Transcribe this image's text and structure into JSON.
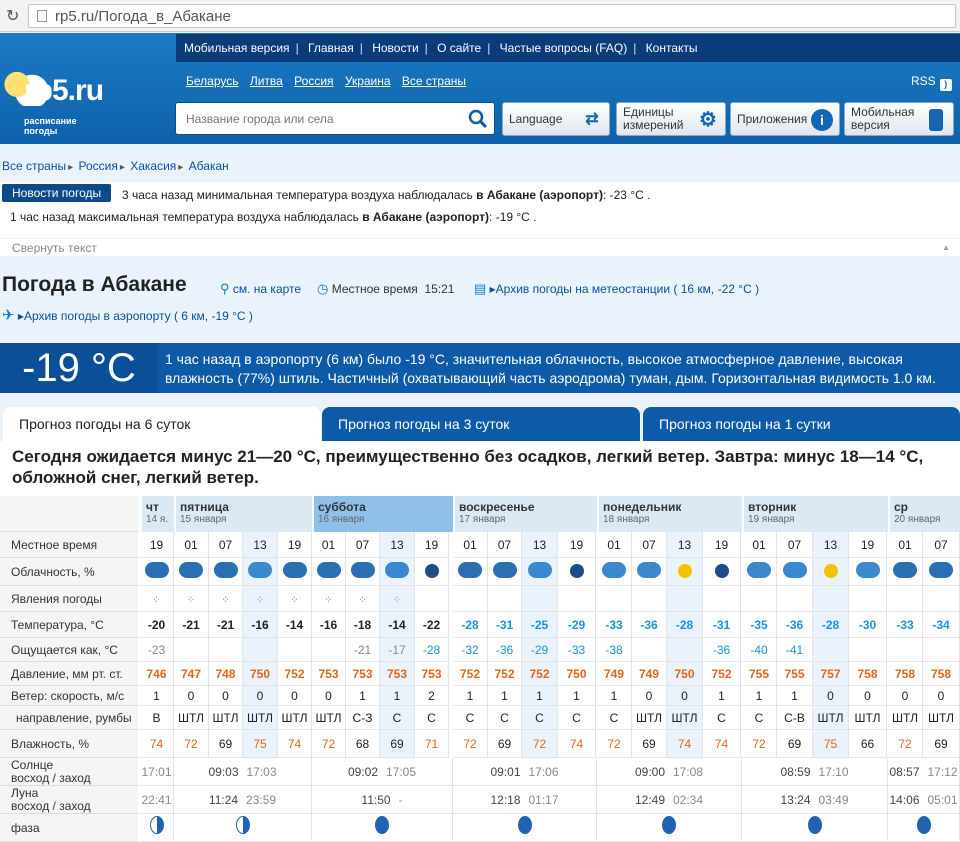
{
  "browser": {
    "url": "rp5.ru/Погода_в_Абакане"
  },
  "topnav": [
    "Мобильная версия",
    "Главная",
    "Новости",
    "О сайте",
    "Частые вопросы (FAQ)",
    "Контакты"
  ],
  "logo": {
    "word": "rp5.ru",
    "sub": "расписание погоды"
  },
  "countries": [
    "Беларусь",
    "Литва",
    "Россия",
    "Украина",
    "Все страны"
  ],
  "rss": "RSS",
  "search": {
    "placeholder": "Название города или села"
  },
  "header_buttons": {
    "language": "Language",
    "units": "Единицы измерений",
    "apps": "Приложения",
    "mobile": "Мобильная версия"
  },
  "breadcrumbs": [
    "Все страны",
    "Россия",
    "Хакасия",
    "Абакан"
  ],
  "news": {
    "badge": "Новости погоды",
    "line1_pre": "3 часа назад минимальная температура воздуха наблюдалась ",
    "line1_bold": "в Абакане (аэропорт)",
    "line1_post": ": -23 °C .",
    "line2_pre": "1 час назад максимальная температура воздуха наблюдалась ",
    "line2_bold": "в Абакане (аэропорт)",
    "line2_post": ": -19 °C .",
    "collapse": "Свернуть текст"
  },
  "title": "Погода в Абакане",
  "meta": {
    "map": "см. на карте",
    "local_time_label": "Местное время",
    "local_time": "15:21",
    "archive_station": "Архив погоды на метеостанции ( 16 км, -22 °C )",
    "archive_airport": "Архив погоды в аэропорту ( 6 км, -19 °C )"
  },
  "now": {
    "temp": "-19 °C",
    "desc": "1 час назад в аэропорту (6 км) было -19 °C, значительная облачность, высокое атмосферное давление, высокая влажность (77%) штиль. Частичный (охватывающий часть аэродрома) туман, дым. Горизонтальная видимость 1.0 км."
  },
  "tabs": [
    "Прогноз погоды на 6 суток",
    "Прогноз погоды на 3 суток",
    "Прогноз погоды на 1 сутки"
  ],
  "summary": "Сегодня ожидается минус 21—20 °C, преимущественно без осадков, легкий ветер. Завтра: минус 18—14 °C, обложной снег, легкий ветер.",
  "days": [
    {
      "name": "чт",
      "date": "14 я."
    },
    {
      "name": "пятница",
      "date": "15 января"
    },
    {
      "name": "суббота",
      "date": "16 января"
    },
    {
      "name": "воскресенье",
      "date": "17 января"
    },
    {
      "name": "понедельник",
      "date": "18 января"
    },
    {
      "name": "вторник",
      "date": "19 января"
    },
    {
      "name": "ср",
      "date": "20 января"
    }
  ],
  "row_labels": {
    "time": "Местное время",
    "cloud": "Облачность, %",
    "phen": "Явления погоды",
    "temp": "Температура, °C",
    "feels": "Ощущается как, °C",
    "pressure": "Давление, мм рт. ст.",
    "wind1": "Ветер: скорость, м/с",
    "wind2": "направление, румбы",
    "humidity": "Влажность, %",
    "sun1": "Солнце",
    "sun2": "восход / заход",
    "moon1": "Луна",
    "moon2": "восход / заход",
    "phase": "фаза"
  },
  "times": [
    "19",
    "01",
    "07",
    "13",
    "19",
    "01",
    "07",
    "13",
    "19",
    "01",
    "07",
    "13",
    "19",
    "01",
    "07",
    "13",
    "19",
    "01",
    "07",
    "13",
    "19",
    "01",
    "07"
  ],
  "cloud_icons": [
    "cloud",
    "cloud",
    "cloud",
    "light",
    "cloud",
    "cloud",
    "cloud",
    "light",
    "night",
    "cloud",
    "cloud",
    "light",
    "night",
    "light",
    "light",
    "sun",
    "night",
    "light",
    "light",
    "sun",
    "light",
    "cloud",
    "cloud"
  ],
  "temps": [
    "-20",
    "-21",
    "-21",
    "-16",
    "-14",
    "-16",
    "-18",
    "-14",
    "-22",
    "-28",
    "-31",
    "-25",
    "-29",
    "-33",
    "-36",
    "-28",
    "-31",
    "-35",
    "-36",
    "-28",
    "-30",
    "-33",
    "-34"
  ],
  "feels": [
    "-23",
    "",
    "",
    "",
    "",
    "",
    "-21",
    "-17",
    "-28",
    "-32",
    "-36",
    "-29",
    "-33",
    "-38",
    "",
    "",
    "-36",
    "-40",
    "-41",
    "",
    "",
    "",
    ""
  ],
  "pressure": [
    "746",
    "747",
    "748",
    "750",
    "752",
    "753",
    "753",
    "753",
    "753",
    "752",
    "752",
    "752",
    "750",
    "749",
    "749",
    "750",
    "752",
    "755",
    "755",
    "757",
    "758",
    "758",
    "758"
  ],
  "wind_speed": [
    "1",
    "0",
    "0",
    "0",
    "0",
    "0",
    "1",
    "1",
    "2",
    "1",
    "1",
    "1",
    "1",
    "1",
    "0",
    "0",
    "1",
    "1",
    "1",
    "0",
    "0",
    "0",
    "0"
  ],
  "wind_dir": [
    "В",
    "ШТЛ",
    "ШТЛ",
    "ШТЛ",
    "ШТЛ",
    "ШТЛ",
    "С-З",
    "С",
    "С",
    "С",
    "С",
    "С",
    "С",
    "С",
    "ШТЛ",
    "ШТЛ",
    "С",
    "С",
    "С-В",
    "ШТЛ",
    "ШТЛ",
    "ШТЛ",
    "ШТЛ"
  ],
  "humidity": [
    "74",
    "72",
    "69",
    "75",
    "74",
    "72",
    "68",
    "69",
    "71",
    "72",
    "69",
    "72",
    "74",
    "72",
    "69",
    "74",
    "74",
    "72",
    "69",
    "75",
    "66",
    "72",
    "69"
  ],
  "sun_rise": [
    "",
    "09:03",
    "",
    "09:02",
    "",
    "09:01",
    "",
    "09:00",
    "",
    "08:59",
    "",
    "08:57"
  ],
  "sun_set": [
    "17:01",
    "17:03",
    "",
    "17:05",
    "",
    "17:06",
    "",
    "17:08",
    "",
    "17:10",
    "",
    "17:12"
  ],
  "moon_rise": [
    "",
    "11:24",
    "",
    "11:50",
    "",
    "12:18",
    "",
    "12:49",
    "",
    "13:24",
    "",
    "14:06"
  ],
  "moon_set": [
    "22:41",
    "23:59",
    "",
    "-",
    "",
    "01:17",
    "",
    "02:34",
    "",
    "03:49",
    "",
    "05:01"
  ],
  "colors": {
    "header": "#1b7ac4",
    "nav": "#0a3c7a",
    "now": "#0d5aa8",
    "accent_orange": "#e0651b",
    "accent_blue": "#1b93d4"
  }
}
